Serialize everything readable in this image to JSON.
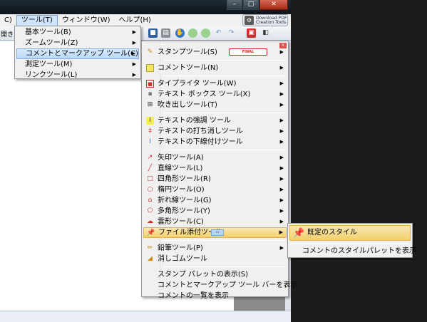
{
  "menubar": {
    "items": [
      {
        "label": "C)"
      },
      {
        "label": "ツール(T)"
      },
      {
        "label": "ウィンドウ(W)"
      },
      {
        "label": "ヘルプ(H)"
      }
    ],
    "pdf_button": {
      "line1": "Download PDF",
      "line2": "Creation Tools"
    }
  },
  "toolbar": {
    "left_fragment": "開き"
  },
  "tools_menu": {
    "items": [
      {
        "label": "基本ツール(B)"
      },
      {
        "label": "ズームツール(Z)"
      },
      {
        "label": "コメントとマークアップ ツール(C)"
      },
      {
        "label": "測定ツール(M)"
      },
      {
        "label": "リンクツール(L)"
      }
    ]
  },
  "markup_menu": {
    "stamp": {
      "label": "スタンプツール(S)",
      "badge": "FINAL"
    },
    "group2": [
      {
        "label": "コメントツール(N)"
      }
    ],
    "group3": [
      {
        "label": "タイプライタ ツール(W)"
      },
      {
        "label": "テキスト ボックス ツール(X)"
      },
      {
        "label": "吹き出しツール(T)"
      }
    ],
    "group4": [
      {
        "label": "テキストの強調 ツール"
      },
      {
        "label": "テキストの打ち消しツール"
      },
      {
        "label": "テキストの下線付けツール"
      }
    ],
    "group5": [
      {
        "label": "矢印ツール(A)"
      },
      {
        "label": "直線ツール(L)"
      },
      {
        "label": "四角形ツール(R)"
      },
      {
        "label": "楕円ツール(O)"
      },
      {
        "label": "折れ線ツール(G)"
      },
      {
        "label": "多角形ツール(Y)"
      },
      {
        "label": "雲形ツール(C)"
      },
      {
        "label": "ファイル添付ツール"
      }
    ],
    "group6": [
      {
        "label": "鉛筆ツール(P)"
      },
      {
        "label": "消しゴムツール"
      }
    ],
    "group7": [
      {
        "label": "スタンプ パレットの表示(S)"
      },
      {
        "label": "コメントとマークアップ ツール バーを表示"
      },
      {
        "label": "コメントの一覧を表示"
      }
    ]
  },
  "attach_submenu": {
    "items": [
      {
        "label": "既定のスタイル"
      },
      {
        "label": "コメントのスタイルパレットを表示"
      }
    ]
  },
  "colors": {
    "highlight": "#f2cf6a",
    "highlight_border": "#e3b248",
    "menu_bg": "#f0f0f0",
    "title_bar": "#0e151b",
    "close_button": "#a62b16"
  }
}
